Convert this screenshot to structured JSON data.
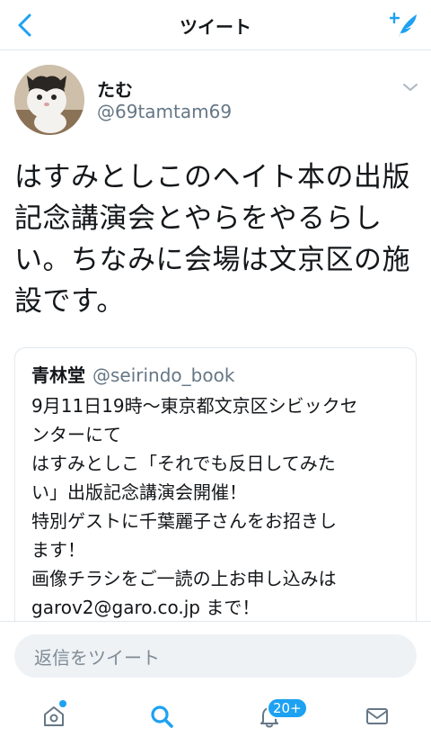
{
  "header": {
    "title": "ツイート",
    "back_icon": "chevron-left-icon",
    "compose_icon": "compose-tweet-icon"
  },
  "author": {
    "name": "たむ",
    "handle": "@69tamtam69",
    "avatar": "cat-avatar",
    "caret_icon": "chevron-down-icon"
  },
  "tweet": {
    "text": "はすみとしこのヘイト本の出版\n記念講演会とやらをやるらし\nい。ちなみに会場は文京区の施\n設です。"
  },
  "quoted_tweet": {
    "name": "青林堂",
    "handle": "@seirindo_book",
    "text": "9月11日19時〜東京都文京区シビックセ\nンターにて\nはすみとしこ「それでも反日してみた\nい」出版記念講演会開催！\n特別ゲストに千葉麗子さんをお招きし\nます！\n画像チラシをご一読の上お申し込みは\ngarov2@garo.co.jp まで！"
  },
  "reply": {
    "placeholder": "返信をツイート"
  },
  "tabbar": {
    "items": [
      {
        "icon": "home-icon"
      },
      {
        "icon": "search-icon"
      },
      {
        "icon": "bell-icon",
        "badge": "20+"
      },
      {
        "icon": "mail-icon"
      }
    ]
  },
  "colors": {
    "accent": "#1da1f2",
    "text": "#14171a",
    "secondary": "#657786",
    "border": "#e1e8ed"
  }
}
